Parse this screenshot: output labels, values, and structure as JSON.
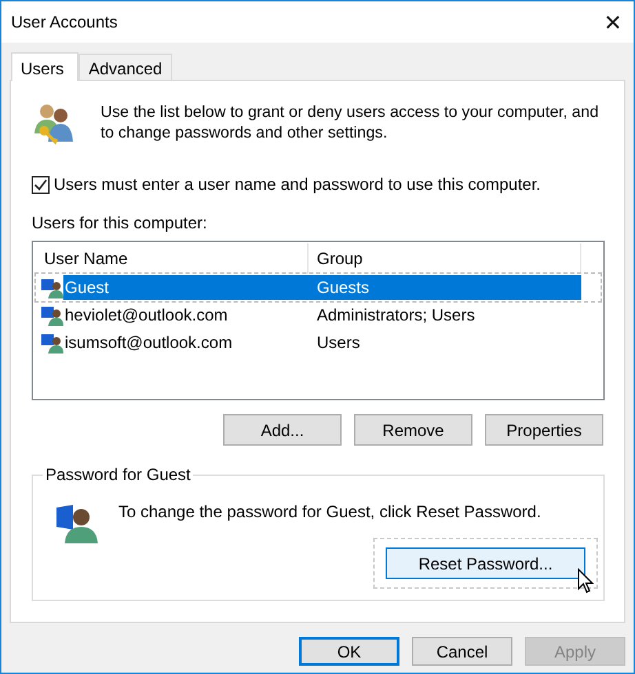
{
  "window": {
    "title": "User Accounts",
    "close": "✕"
  },
  "tabs": [
    {
      "label": "Users",
      "selected": true
    },
    {
      "label": "Advanced",
      "selected": false
    }
  ],
  "intro": "Use the list below to grant or deny users access to your computer, and to change passwords and other settings.",
  "login_required": {
    "label": "Users must enter a user name and password to use this computer.",
    "checked": true
  },
  "list_label": "Users for this computer:",
  "columns": [
    "User Name",
    "Group"
  ],
  "rows": [
    {
      "user_name": "Guest",
      "group": "Guests",
      "selected": true
    },
    {
      "user_name": "heviolet@outlook.com",
      "group": "Administrators; Users",
      "selected": false
    },
    {
      "user_name": "isumsoft@outlook.com",
      "group": "Users",
      "selected": false
    }
  ],
  "list_buttons": [
    "Add...",
    "Remove",
    "Properties"
  ],
  "password_group": {
    "title": "Password for Guest",
    "text": "To change the password for Guest, click Reset Password.",
    "button": "Reset Password..."
  },
  "dialog_buttons": [
    {
      "label": "OK",
      "default": true,
      "disabled": false
    },
    {
      "label": "Cancel",
      "default": false,
      "disabled": false
    },
    {
      "label": "Apply",
      "default": false,
      "disabled": true
    }
  ]
}
